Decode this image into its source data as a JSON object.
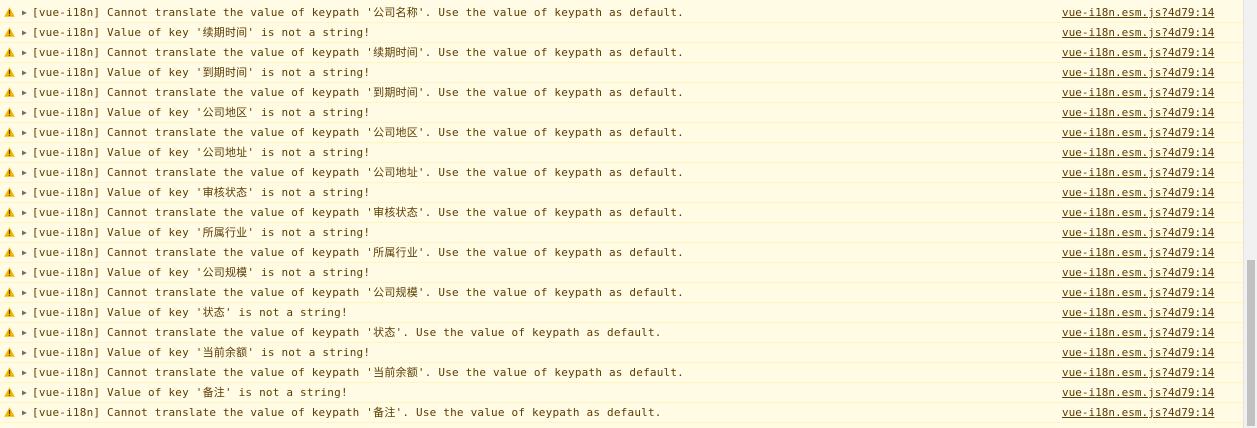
{
  "console": {
    "rows": [
      {
        "message": "[vue-i18n] Cannot translate the value of keypath '公司名称'. Use the value of keypath as default.",
        "source": "vue-i18n.esm.js?4d79:14"
      },
      {
        "message": "[vue-i18n] Value of key '续期时间' is not a string!",
        "source": "vue-i18n.esm.js?4d79:14"
      },
      {
        "message": "[vue-i18n] Cannot translate the value of keypath '续期时间'. Use the value of keypath as default.",
        "source": "vue-i18n.esm.js?4d79:14"
      },
      {
        "message": "[vue-i18n] Value of key '到期时间' is not a string!",
        "source": "vue-i18n.esm.js?4d79:14"
      },
      {
        "message": "[vue-i18n] Cannot translate the value of keypath '到期时间'. Use the value of keypath as default.",
        "source": "vue-i18n.esm.js?4d79:14"
      },
      {
        "message": "[vue-i18n] Value of key '公司地区' is not a string!",
        "source": "vue-i18n.esm.js?4d79:14"
      },
      {
        "message": "[vue-i18n] Cannot translate the value of keypath '公司地区'. Use the value of keypath as default.",
        "source": "vue-i18n.esm.js?4d79:14"
      },
      {
        "message": "[vue-i18n] Value of key '公司地址' is not a string!",
        "source": "vue-i18n.esm.js?4d79:14"
      },
      {
        "message": "[vue-i18n] Cannot translate the value of keypath '公司地址'. Use the value of keypath as default.",
        "source": "vue-i18n.esm.js?4d79:14"
      },
      {
        "message": "[vue-i18n] Value of key '审核状态' is not a string!",
        "source": "vue-i18n.esm.js?4d79:14"
      },
      {
        "message": "[vue-i18n] Cannot translate the value of keypath '审核状态'. Use the value of keypath as default.",
        "source": "vue-i18n.esm.js?4d79:14"
      },
      {
        "message": "[vue-i18n] Value of key '所属行业' is not a string!",
        "source": "vue-i18n.esm.js?4d79:14"
      },
      {
        "message": "[vue-i18n] Cannot translate the value of keypath '所属行业'. Use the value of keypath as default.",
        "source": "vue-i18n.esm.js?4d79:14"
      },
      {
        "message": "[vue-i18n] Value of key '公司规模' is not a string!",
        "source": "vue-i18n.esm.js?4d79:14"
      },
      {
        "message": "[vue-i18n] Cannot translate the value of keypath '公司规模'. Use the value of keypath as default.",
        "source": "vue-i18n.esm.js?4d79:14"
      },
      {
        "message": "[vue-i18n] Value of key '状态' is not a string!",
        "source": "vue-i18n.esm.js?4d79:14"
      },
      {
        "message": "[vue-i18n] Cannot translate the value of keypath '状态'. Use the value of keypath as default.",
        "source": "vue-i18n.esm.js?4d79:14"
      },
      {
        "message": "[vue-i18n] Value of key '当前余额' is not a string!",
        "source": "vue-i18n.esm.js?4d79:14"
      },
      {
        "message": "[vue-i18n] Cannot translate the value of keypath '当前余额'. Use the value of keypath as default.",
        "source": "vue-i18n.esm.js?4d79:14"
      },
      {
        "message": "[vue-i18n] Value of key '备注' is not a string!",
        "source": "vue-i18n.esm.js?4d79:14"
      },
      {
        "message": "[vue-i18n] Cannot translate the value of keypath '备注'. Use the value of keypath as default.",
        "source": "vue-i18n.esm.js?4d79:14"
      }
    ],
    "icons": {
      "warning": "warning-icon",
      "expand": "expand-triangle-icon"
    },
    "colors": {
      "background": "#fffbe5",
      "text": "#5c3c00",
      "warning_icon": "#f2b600",
      "row_divider": "#fff5c2"
    }
  }
}
